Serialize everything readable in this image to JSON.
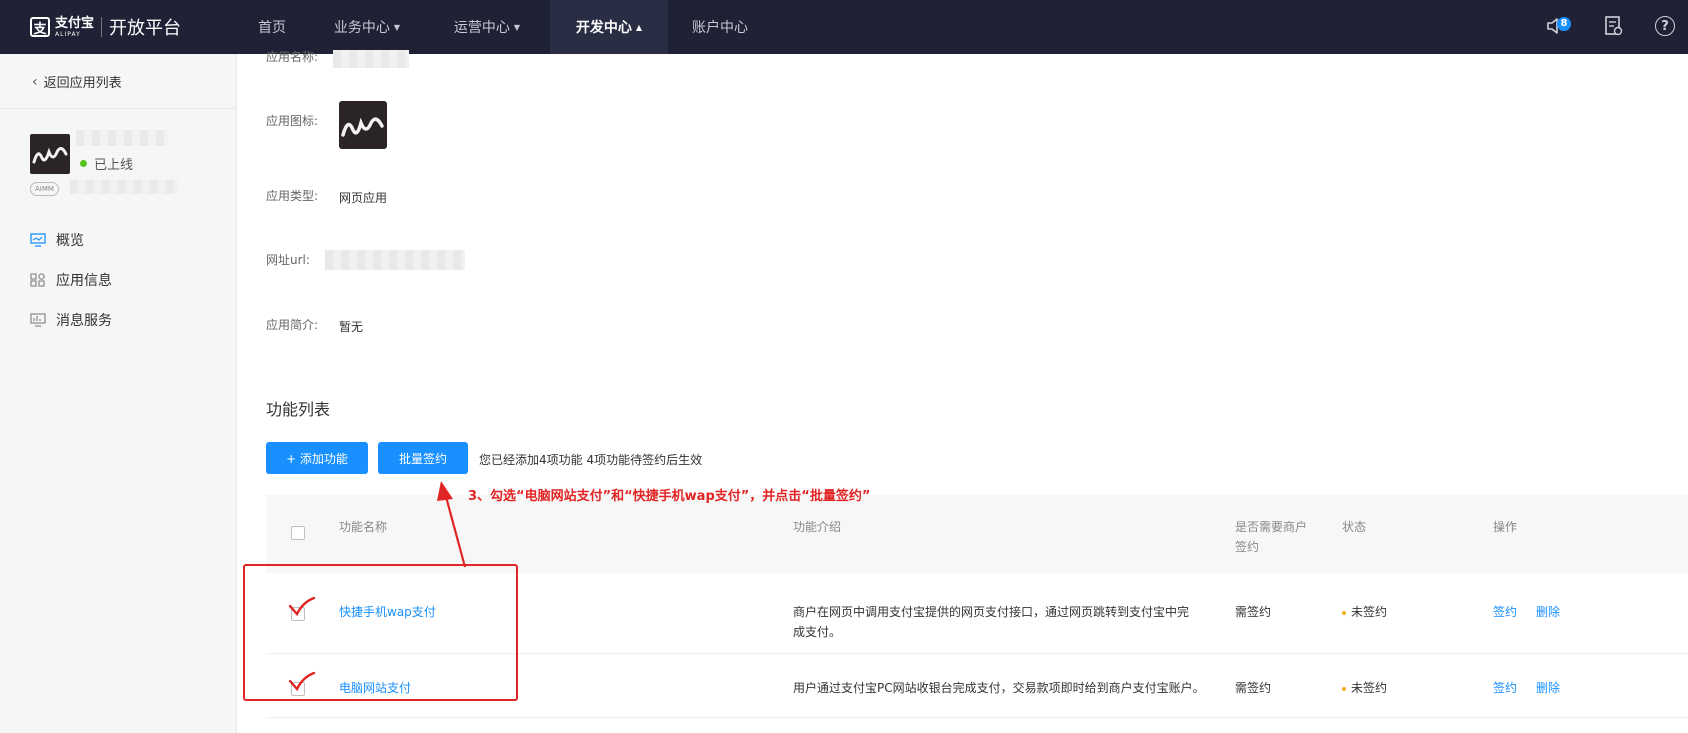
{
  "topbar": {
    "logo_mark": "支",
    "logo_cn": "支付宝",
    "logo_en": "ALIPAY",
    "platform": "开放平台",
    "nav": [
      {
        "label": "首页"
      },
      {
        "label": "业务中心"
      },
      {
        "label": "运营中心"
      },
      {
        "label": "开发中心"
      },
      {
        "label": "账户中心"
      }
    ],
    "notification_count": "8",
    "help": "?"
  },
  "sidebar": {
    "back_label": "返回应用列表",
    "status": "已上线",
    "app_tag": "AIMM",
    "menu": [
      {
        "label": "概览",
        "icon": "monitor-icon"
      },
      {
        "label": "应用信息",
        "icon": "apps-icon"
      },
      {
        "label": "消息服务",
        "icon": "chart-icon"
      }
    ]
  },
  "app_info": {
    "name_label": "应用名称:",
    "icon_label": "应用图标:",
    "type_label": "应用类型:",
    "type_value": "网页应用",
    "url_label": "网址url:",
    "intro_label": "应用简介:",
    "intro_value": "暂无"
  },
  "features": {
    "section_title": "功能列表",
    "add_button": "+ 添加功能",
    "batch_button": "批量签约",
    "summary": "您已经添加4项功能   4项功能待签约后生效",
    "annotation": "3、勾选“电脑网站支付”和“快捷手机wap支付”，并点击“批量签约”",
    "columns": {
      "name": "功能名称",
      "desc": "功能介绍",
      "need_sign": "是否需要商户签约",
      "status": "状态",
      "action": "操作"
    },
    "rows": [
      {
        "name": "快捷手机wap支付",
        "desc": "商户在网页中调用支付宝提供的网页支付接口，通过网页跳转到支付宝中完成支付。",
        "need_sign": "需签约",
        "status": "未签约",
        "sign": "签约",
        "delete": "删除"
      },
      {
        "name": "电脑网站支付",
        "desc": "用户通过支付宝PC网站收银台完成支付，交易款项即时给到商户支付宝账户。",
        "need_sign": "需签约",
        "status": "未签约",
        "sign": "签约",
        "delete": "删除"
      }
    ]
  },
  "colors": {
    "nav_bg": "#1f2235",
    "primary": "#1890ff",
    "annotation_red": "#e12424",
    "online_green": "#52c41a",
    "pending_orange": "#faad14"
  }
}
